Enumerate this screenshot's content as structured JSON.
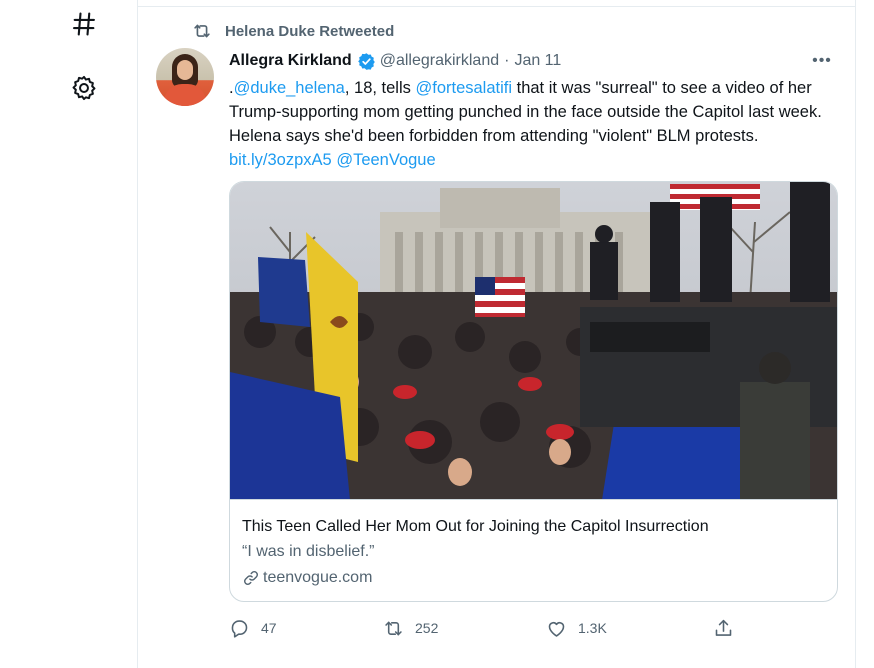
{
  "retweet": {
    "label": "Helena Duke Retweeted"
  },
  "tweet": {
    "display_name": "Allegra Kirkland",
    "handle": "@allegrakirkland",
    "separator": "·",
    "date": "Jan 11",
    "more": "•••",
    "text": {
      "t0": ".",
      "mention1": "@duke_helena",
      "t1": ", 18, tells ",
      "mention2": "@fortesalatifi",
      "t2": " that it was \"surreal\" to see a video of her Trump-supporting mom getting punched in the face outside the Capitol last week. Helena says she'd been forbidden from attending \"violent\" BLM protests. ",
      "url": "bit.ly/3ozpxA5",
      "t3": " ",
      "mention3": "@TeenVogue"
    }
  },
  "card": {
    "title": "This Teen Called Her Mom Out for Joining the Capitol Insurrection",
    "description": "“I was in disbelief.”",
    "domain": "teenvogue.com"
  },
  "actions": {
    "replies": "47",
    "retweets": "252",
    "likes": "1.3K"
  },
  "icons": {
    "nav": [
      "hashtag-icon",
      "settings-gear-icon"
    ],
    "tweet": [
      "retweet-icon",
      "verified-badge-icon",
      "more-icon",
      "link-icon",
      "reply-icon",
      "like-icon",
      "share-icon"
    ]
  },
  "colors": {
    "accent": "#1d9bf0",
    "secondary_text": "#536471",
    "border": "#cfd9de"
  }
}
